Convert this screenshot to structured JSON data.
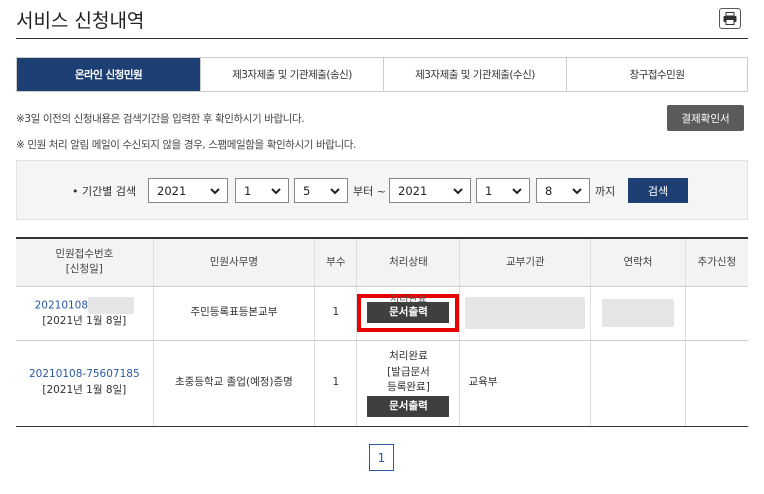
{
  "header": {
    "title": "서비스 신청내역",
    "print_icon": "printer-icon"
  },
  "tabs": [
    {
      "label": "온라인 신청민원",
      "active": true
    },
    {
      "label": "제3자제출 및 기관제출(송신)",
      "active": false
    },
    {
      "label": "제3자제출 및 기관제출(수신)",
      "active": false
    },
    {
      "label": "창구접수민원",
      "active": false
    }
  ],
  "notices": {
    "line1": "※3일 이전의 신청내용은 검색기간을 입력한 후 확인하시기 바랍니다.",
    "line2": "※ 민원 처리 알림 메일이 수신되지 않을 경우, 스팸메일함을 확인하시기 바랍니다."
  },
  "receipt_button": "결제확인서",
  "search": {
    "label": "• 기간별 검색",
    "from_year": "2021",
    "from_month": "1",
    "from_day": "5",
    "from_word": "부터 ~",
    "to_year": "2021",
    "to_month": "1",
    "to_day": "8",
    "to_word": "까지",
    "button": "검색"
  },
  "table": {
    "headers": {
      "receipt_no_1": "민원접수번호",
      "receipt_no_2": "[신청일]",
      "service": "민원사무명",
      "copies": "부수",
      "status": "처리상태",
      "issuer": "교부기관",
      "contact": "연락처",
      "extra": "추가신청"
    },
    "rows": [
      {
        "receipt_no": "20210108",
        "date": "[2021년 1월 8일]",
        "service": "주민등록표등본교부",
        "copies": "1",
        "status_partial": "처리완료",
        "button": "문서출력"
      },
      {
        "receipt_no": "20210108-75607185",
        "date": "[2021년 1월 8일]",
        "service": "초중등학교 졸업(예정)증명",
        "copies": "1",
        "status_1": "처리완료",
        "status_2": "[발급문서",
        "status_3": "등록완료]",
        "issuer": "교육부",
        "button": "문서출력"
      }
    ]
  },
  "pagination": {
    "current": "1"
  },
  "colors": {
    "navy": "#1e3f73",
    "highlight_red": "#e60000",
    "dark_button": "#3f3f3f"
  }
}
